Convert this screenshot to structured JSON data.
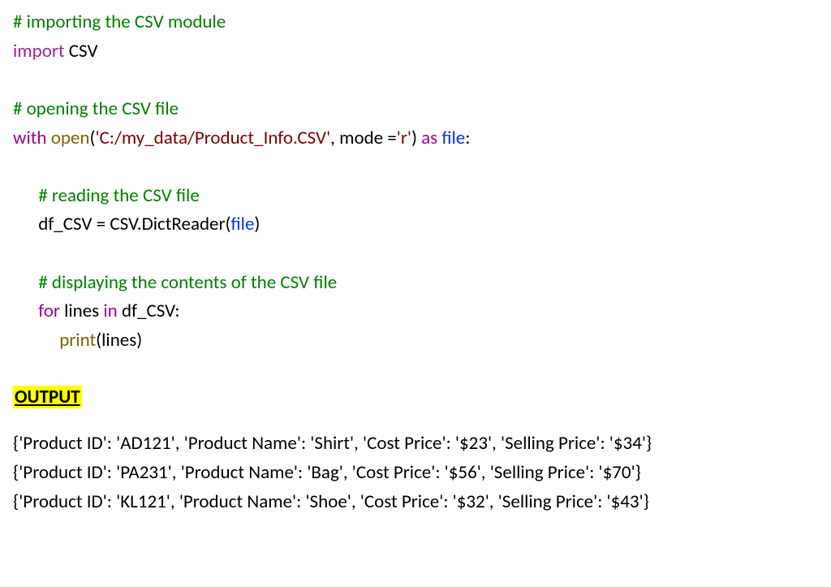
{
  "code": {
    "c1": "# importing the CSV module",
    "l2a": "import",
    "l2b": " CSV",
    "blank1": " ",
    "c2": "# opening the CSV file",
    "l4a": "with",
    "l4b": " ",
    "l4c": "open",
    "l4d": "(",
    "l4e": "'C:/my_data/Product_Info.CSV'",
    "l4f": ", mode =",
    "l4g": "'r'",
    "l4h": ") ",
    "l4i": "as",
    "l4j": " ",
    "l4k": "file",
    "l4l": ":",
    "blank2": " ",
    "indent": "      ",
    "c3": "# reading the CSV file",
    "l6a": "df_CSV = CSV.DictReader(",
    "l6b": "file",
    "l6c": ")",
    "blank3": " ",
    "c4": "# displaying the contents of the CSV file",
    "l8a": "for",
    "l8b": " lines ",
    "l8c": "in",
    "l8d": " df_CSV:",
    "indent2": "           ",
    "l9a": "print",
    "l9b": "(lines)"
  },
  "output_label": "OUTPUT",
  "output": [
    "{'Product ID': 'AD121', 'Product Name': 'Shirt', 'Cost Price': '$23', 'Selling Price': '$34'}",
    "{'Product ID': 'PA231', 'Product Name': 'Bag', 'Cost Price': '$56', 'Selling Price': '$70'}",
    "{'Product ID': 'KL121', 'Product Name': 'Shoe', 'Cost Price': '$32', 'Selling Price': '$43'}"
  ]
}
